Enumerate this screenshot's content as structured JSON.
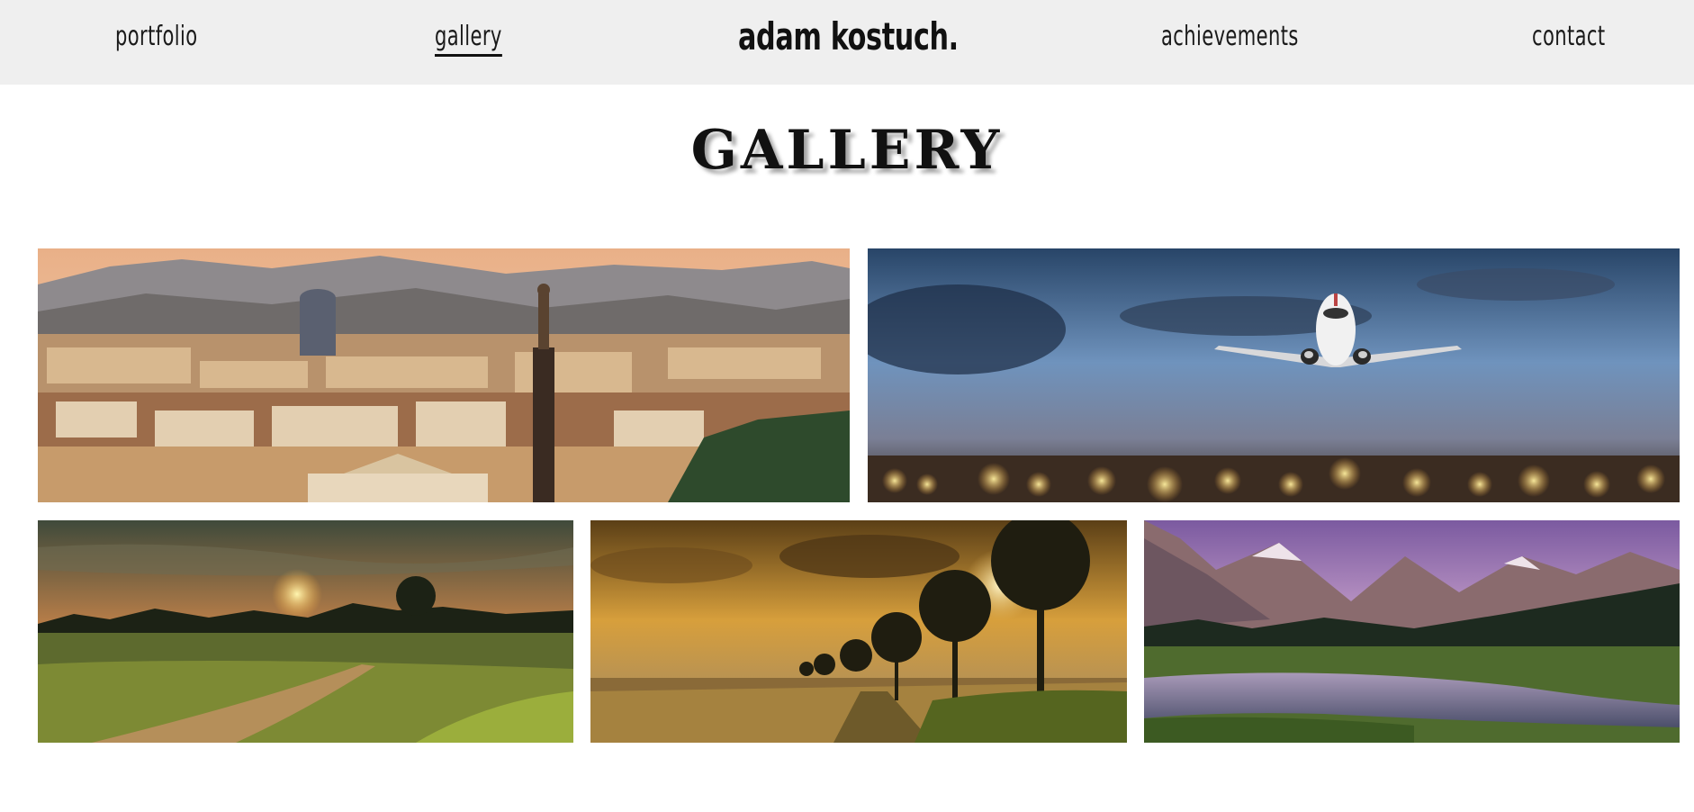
{
  "nav": {
    "portfolio": "portfolio",
    "gallery": "gallery",
    "brand": "adam kostuch.",
    "achievements": "achievements",
    "contact": "contact"
  },
  "page": {
    "title": "GALLERY"
  },
  "gallery": [
    {
      "subject": "city skyline with mountains"
    },
    {
      "subject": "airplane in flight at dusk"
    },
    {
      "subject": "sunset over meadow with dirt road"
    },
    {
      "subject": "golden sky over trees and field"
    },
    {
      "subject": "mountains reflected in lake"
    }
  ]
}
